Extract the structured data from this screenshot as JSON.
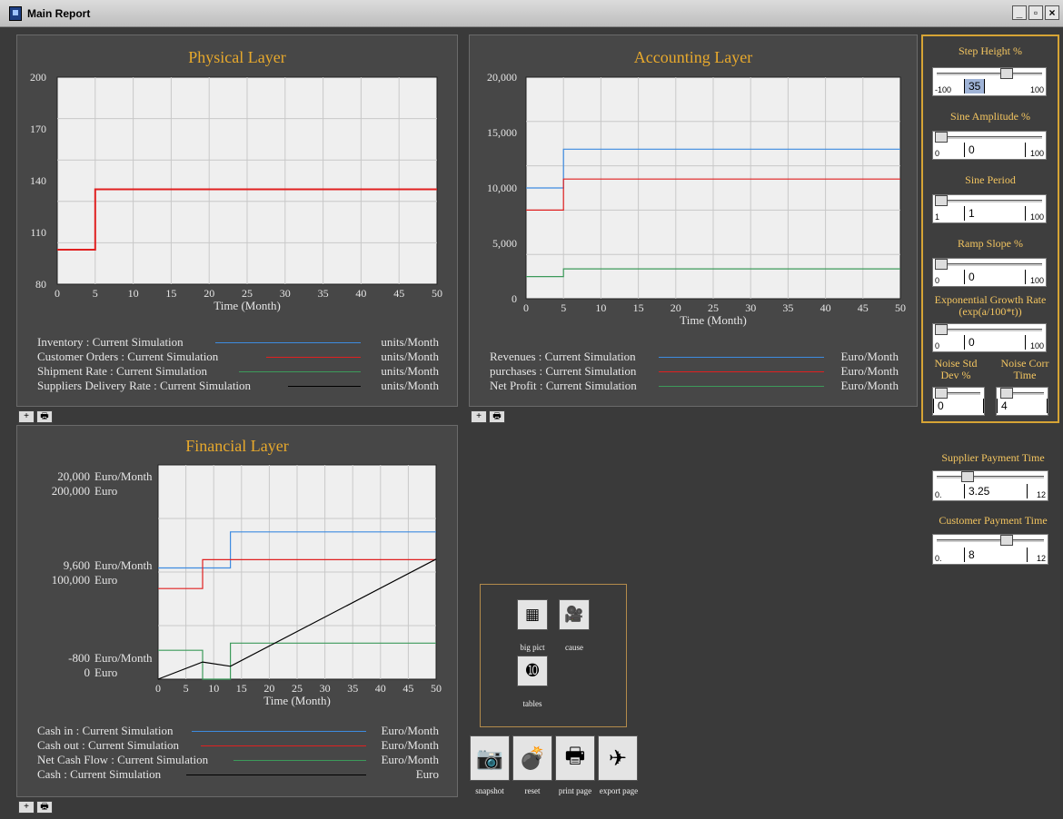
{
  "window": {
    "title": "Main Report",
    "controls": [
      "_",
      "▫",
      "×"
    ]
  },
  "physical": {
    "title": "Physical Layer",
    "legend": [
      {
        "name": "Inventory : Current Simulation",
        "unit": "units/Month",
        "color": "#3d8be0"
      },
      {
        "name": "Customer Orders : Current Simulation",
        "unit": "units/Month",
        "color": "#e02020"
      },
      {
        "name": "Shipment Rate : Current Simulation",
        "unit": "units/Month",
        "color": "#3c9a5a"
      },
      {
        "name": "Suppliers Delivery Rate : Current Simulation",
        "unit": "units/Month",
        "color": "#000000"
      }
    ]
  },
  "accounting": {
    "title": "Accounting Layer",
    "legend": [
      {
        "name": "Revenues : Current Simulation",
        "unit": "Euro/Month",
        "color": "#3d8be0"
      },
      {
        "name": "purchases : Current Simulation",
        "unit": "Euro/Month",
        "color": "#e02020"
      },
      {
        "name": "Net Profit : Current Simulation",
        "unit": "Euro/Month",
        "color": "#3c9a5a"
      }
    ]
  },
  "financial": {
    "title": "Financial Layer",
    "y_labels": [
      {
        "a": "20,000",
        "a_unit": "Euro/Month",
        "b": "200,000",
        "b_unit": "Euro"
      },
      {
        "a": "9,600",
        "a_unit": "Euro/Month",
        "b": "100,000",
        "b_unit": "Euro"
      },
      {
        "a": "-800",
        "a_unit": "Euro/Month",
        "b": "0",
        "b_unit": "Euro"
      }
    ],
    "legend": [
      {
        "name": "Cash in : Current Simulation",
        "unit": "Euro/Month",
        "color": "#3d8be0"
      },
      {
        "name": "Cash out : Current Simulation",
        "unit": "Euro/Month",
        "color": "#e02020"
      },
      {
        "name": "Net Cash Flow : Current Simulation",
        "unit": "Euro/Month",
        "color": "#3c9a5a"
      },
      {
        "name": "Cash : Current Simulation",
        "unit": "Euro",
        "color": "#000000"
      }
    ]
  },
  "controls": {
    "step_height": {
      "label": "Step Height %",
      "min": "-100",
      "max": "100",
      "value": "35",
      "fraction": 0.675
    },
    "sine_amplitude": {
      "label": "Sine Amplitude %",
      "min": "0",
      "max": "100",
      "value": "0",
      "fraction": 0
    },
    "sine_period": {
      "label": "Sine Period",
      "min": "1",
      "max": "100",
      "value": "1",
      "fraction": 0
    },
    "ramp_slope": {
      "label": "Ramp Slope %",
      "min": "0",
      "max": "100",
      "value": "0",
      "fraction": 0
    },
    "exp_growth": {
      "label": "Exponential Growth Rate  (exp(a/100*t))",
      "min": "0",
      "max": "100",
      "value": "0",
      "fraction": 0
    },
    "noise_std": {
      "label": "Noise Std Dev %",
      "value": "0",
      "fraction": 0
    },
    "noise_corr": {
      "label": "Noise Corr Time",
      "value": "4",
      "fraction": 0.05
    },
    "supplier_payment": {
      "label": "Supplier Payment Time",
      "min": "0.",
      "max": "12",
      "value": "3.25",
      "fraction": 0.27
    },
    "customer_payment": {
      "label": "Customer Payment Time",
      "min": "0.",
      "max": "12",
      "value": "8",
      "fraction": 0.67
    }
  },
  "nav": {
    "big_pict": "big pict",
    "cause": "cause",
    "tables": "tables",
    "snapshot": "snapshot",
    "reset": "reset",
    "print_page": "print page",
    "export_page": "export page"
  },
  "chart_data": [
    {
      "type": "line",
      "title": "Physical Layer",
      "xlabel": "Time (Month)",
      "ylabel": "",
      "xlim": [
        0,
        50
      ],
      "ylim": [
        80,
        200
      ],
      "xticks": [
        0,
        5,
        10,
        15,
        20,
        25,
        30,
        35,
        40,
        45,
        50
      ],
      "yticks": [
        80,
        110,
        140,
        170,
        200
      ],
      "grid": true,
      "series": [
        {
          "name": "Customer Orders : Current Simulation",
          "color": "#e02020",
          "x": [
            0,
            5,
            5,
            50
          ],
          "y": [
            100,
            100,
            135,
            135
          ]
        }
      ]
    },
    {
      "type": "line",
      "title": "Accounting Layer",
      "xlabel": "Time (Month)",
      "ylabel": "",
      "xlim": [
        0,
        50
      ],
      "ylim": [
        0,
        20000
      ],
      "xticks": [
        0,
        5,
        10,
        15,
        20,
        25,
        30,
        35,
        40,
        45,
        50
      ],
      "yticks": [
        0,
        5000,
        10000,
        15000,
        20000
      ],
      "ytick_labels": [
        "0",
        "5,000",
        "10,000",
        "15,000",
        "20,000"
      ],
      "grid": true,
      "series": [
        {
          "name": "Revenues : Current Simulation",
          "color": "#3d8be0",
          "x": [
            0,
            5,
            5,
            50
          ],
          "y": [
            10000,
            10000,
            13500,
            13500
          ]
        },
        {
          "name": "purchases : Current Simulation",
          "color": "#e02020",
          "x": [
            0,
            5,
            5,
            50
          ],
          "y": [
            8000,
            8000,
            10800,
            10800
          ]
        },
        {
          "name": "Net Profit : Current Simulation",
          "color": "#3c9a5a",
          "x": [
            0,
            5,
            5,
            50
          ],
          "y": [
            2000,
            2000,
            2700,
            2700
          ]
        }
      ]
    },
    {
      "type": "line",
      "title": "Financial Layer",
      "xlabel": "Time (Month)",
      "ylabel": "",
      "xlim": [
        0,
        50
      ],
      "xticks": [
        0,
        5,
        10,
        15,
        20,
        25,
        30,
        35,
        40,
        45,
        50
      ],
      "ylim": [
        -800,
        20000
      ],
      "ylim_cash": [
        0,
        200000
      ],
      "grid": true,
      "series": [
        {
          "name": "Cash in : Current Simulation",
          "color": "#3d8be0",
          "axis": "flow",
          "x": [
            0,
            13,
            13,
            50
          ],
          "y": [
            10000,
            10000,
            13500,
            13500
          ]
        },
        {
          "name": "Cash out : Current Simulation",
          "color": "#e02020",
          "axis": "flow",
          "x": [
            0,
            8,
            8,
            50
          ],
          "y": [
            8000,
            8000,
            10800,
            10800
          ]
        },
        {
          "name": "Net Cash Flow : Current Simulation",
          "color": "#3c9a5a",
          "axis": "flow",
          "x": [
            0,
            8,
            8,
            13,
            13,
            50
          ],
          "y": [
            2000,
            2000,
            -800,
            -800,
            2700,
            2700
          ]
        },
        {
          "name": "Cash : Current Simulation",
          "color": "#000000",
          "axis": "cash",
          "x": [
            0,
            8,
            13,
            50
          ],
          "y": [
            0,
            16000,
            12000,
            112000
          ]
        }
      ]
    }
  ]
}
